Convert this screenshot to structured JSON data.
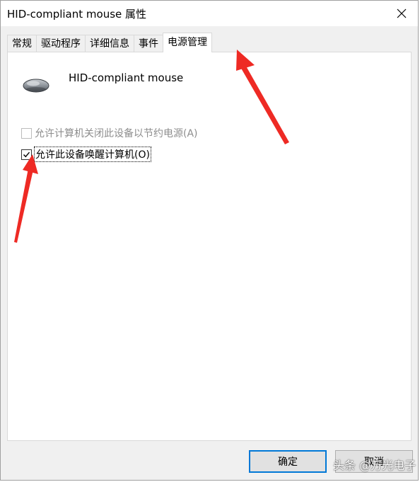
{
  "window": {
    "title": "HID-compliant mouse 属性"
  },
  "tabs": [
    {
      "label": "常规",
      "active": false
    },
    {
      "label": "驱动程序",
      "active": false
    },
    {
      "label": "详细信息",
      "active": false
    },
    {
      "label": "事件",
      "active": false
    },
    {
      "label": "电源管理",
      "active": true
    }
  ],
  "device": {
    "name": "HID-compliant mouse",
    "icon": "mouse-icon"
  },
  "options": {
    "allow_power_off": {
      "label": "允许计算机关闭此设备以节约电源(A)",
      "checked": false,
      "enabled": false
    },
    "allow_wake": {
      "label": "允许此设备唤醒计算机(O)",
      "checked": true,
      "enabled": true
    }
  },
  "buttons": {
    "ok_label": "确定",
    "cancel_label": "取消"
  },
  "annotations": {
    "arrow_color": "#ee2a24"
  },
  "watermark": {
    "text": "头条 @万光电子"
  }
}
